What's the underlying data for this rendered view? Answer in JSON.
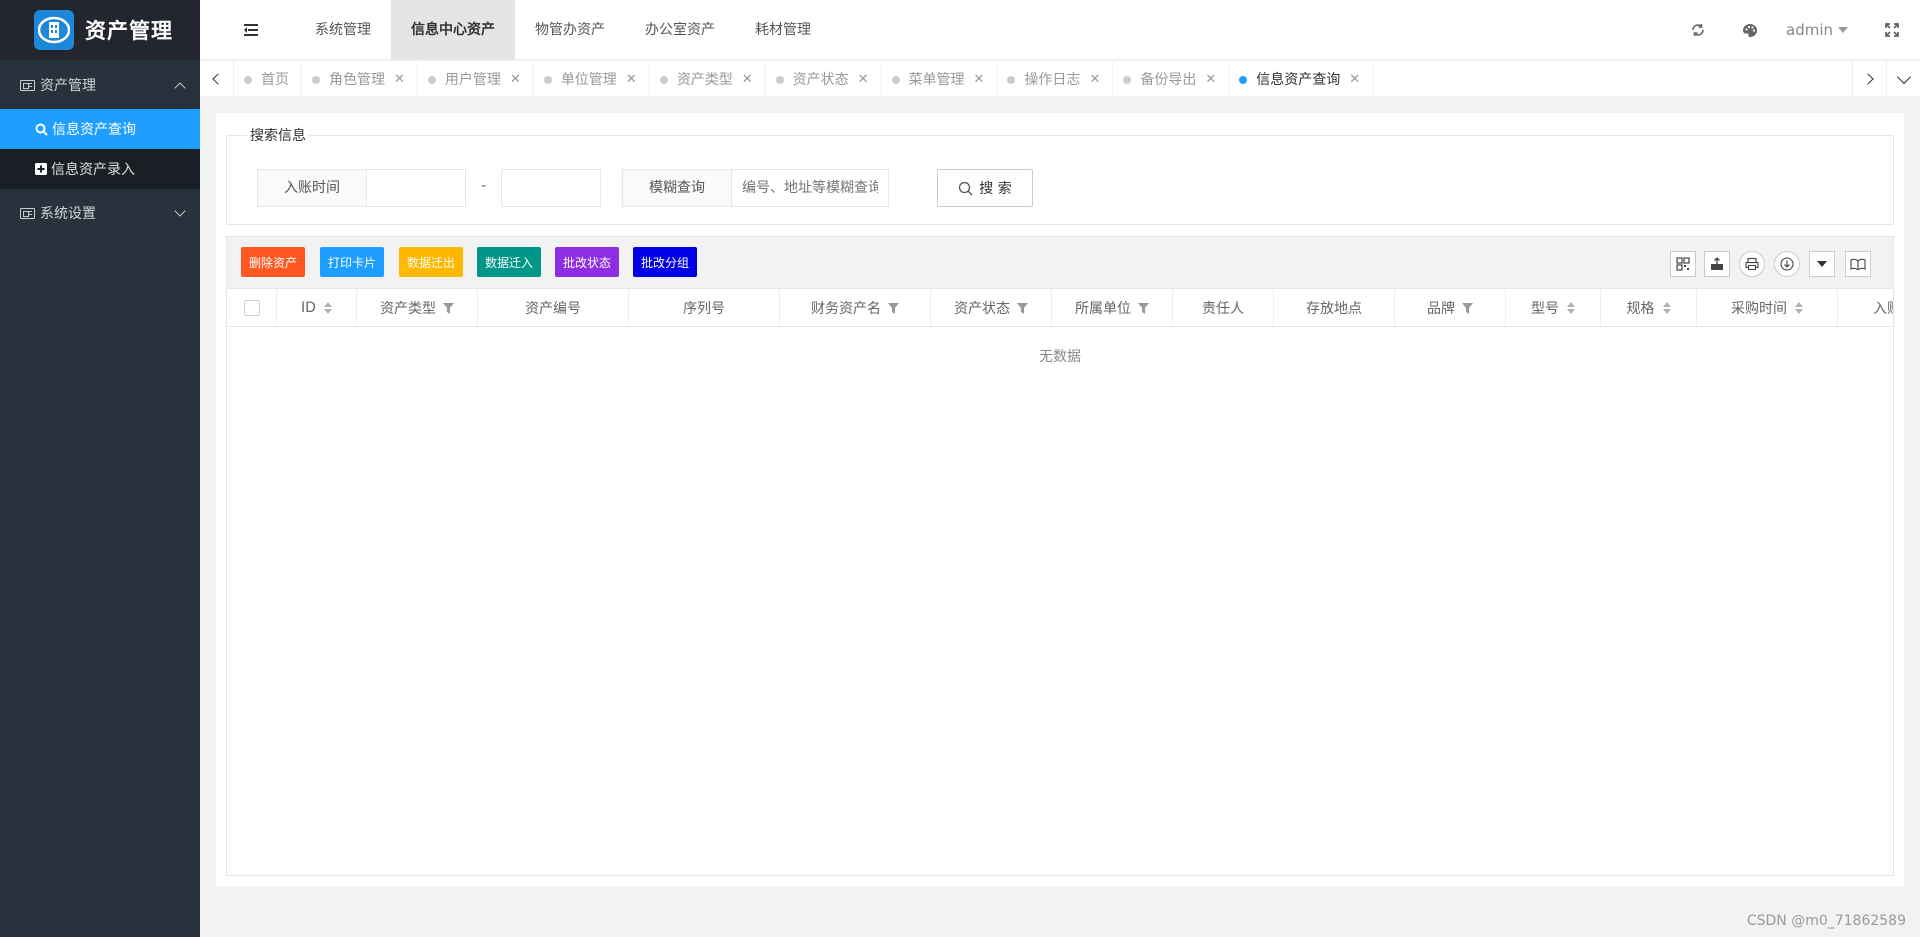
{
  "app": {
    "title": "资产管理"
  },
  "sidebar": {
    "groups": [
      {
        "label": "资产管理",
        "expanded": true,
        "items": [
          {
            "label": "信息资产查询",
            "icon": "search-icon",
            "active": true
          },
          {
            "label": "信息资产录入",
            "icon": "plus-square-icon",
            "active": false
          }
        ]
      },
      {
        "label": "系统设置",
        "expanded": false,
        "items": []
      }
    ]
  },
  "header": {
    "nav": [
      "系统管理",
      "信息中心资产",
      "物管办资产",
      "办公室资产",
      "耗材管理"
    ],
    "active_nav": 1,
    "user": "admin"
  },
  "tabs": [
    {
      "label": "首页",
      "closable": false,
      "active": false
    },
    {
      "label": "角色管理",
      "closable": true,
      "active": false
    },
    {
      "label": "用户管理",
      "closable": true,
      "active": false
    },
    {
      "label": "单位管理",
      "closable": true,
      "active": false
    },
    {
      "label": "资产类型",
      "closable": true,
      "active": false
    },
    {
      "label": "资产状态",
      "closable": true,
      "active": false
    },
    {
      "label": "菜单管理",
      "closable": true,
      "active": false
    },
    {
      "label": "操作日志",
      "closable": true,
      "active": false
    },
    {
      "label": "备份导出",
      "closable": true,
      "active": false
    },
    {
      "label": "信息资产查询",
      "closable": true,
      "active": true
    }
  ],
  "search": {
    "legend": "搜索信息",
    "date_label": "入账时间",
    "date_start": "",
    "date_end": "",
    "range_sep": "-",
    "fuzzy_label": "模糊查询",
    "fuzzy_placeholder": "编号、地址等模糊查询",
    "fuzzy_value": "",
    "button": "搜 索"
  },
  "toolbar": {
    "buttons": [
      {
        "label": "删除资产",
        "color": "#ff5722"
      },
      {
        "label": "打印卡片",
        "color": "#1e9fff"
      },
      {
        "label": "数据迁出",
        "color": "#ffb800"
      },
      {
        "label": "数据迁入",
        "color": "#009688"
      },
      {
        "label": "批改状态",
        "color": "#8e2de2"
      },
      {
        "label": "批改分组",
        "color": "#0000e6"
      }
    ],
    "icons": [
      "grid-icon",
      "export-icon",
      "print-icon",
      "download-icon",
      "caret-down-icon",
      "book-icon"
    ]
  },
  "table": {
    "columns": [
      {
        "label": "ID",
        "sort": true,
        "filter": false
      },
      {
        "label": "资产类型",
        "sort": false,
        "filter": true
      },
      {
        "label": "资产编号",
        "sort": false,
        "filter": false
      },
      {
        "label": "序列号",
        "sort": false,
        "filter": false
      },
      {
        "label": "财务资产名",
        "sort": false,
        "filter": true
      },
      {
        "label": "资产状态",
        "sort": false,
        "filter": true
      },
      {
        "label": "所属单位",
        "sort": false,
        "filter": true
      },
      {
        "label": "责任人",
        "sort": false,
        "filter": false
      },
      {
        "label": "存放地点",
        "sort": false,
        "filter": false
      },
      {
        "label": "品牌",
        "sort": false,
        "filter": true
      },
      {
        "label": "型号",
        "sort": true,
        "filter": false
      },
      {
        "label": "规格",
        "sort": true,
        "filter": false
      },
      {
        "label": "采购时间",
        "sort": true,
        "filter": false
      },
      {
        "label": "入账",
        "sort": false,
        "filter": false
      }
    ],
    "empty_text": "无数据"
  },
  "watermark": "CSDN @m0_71862589"
}
